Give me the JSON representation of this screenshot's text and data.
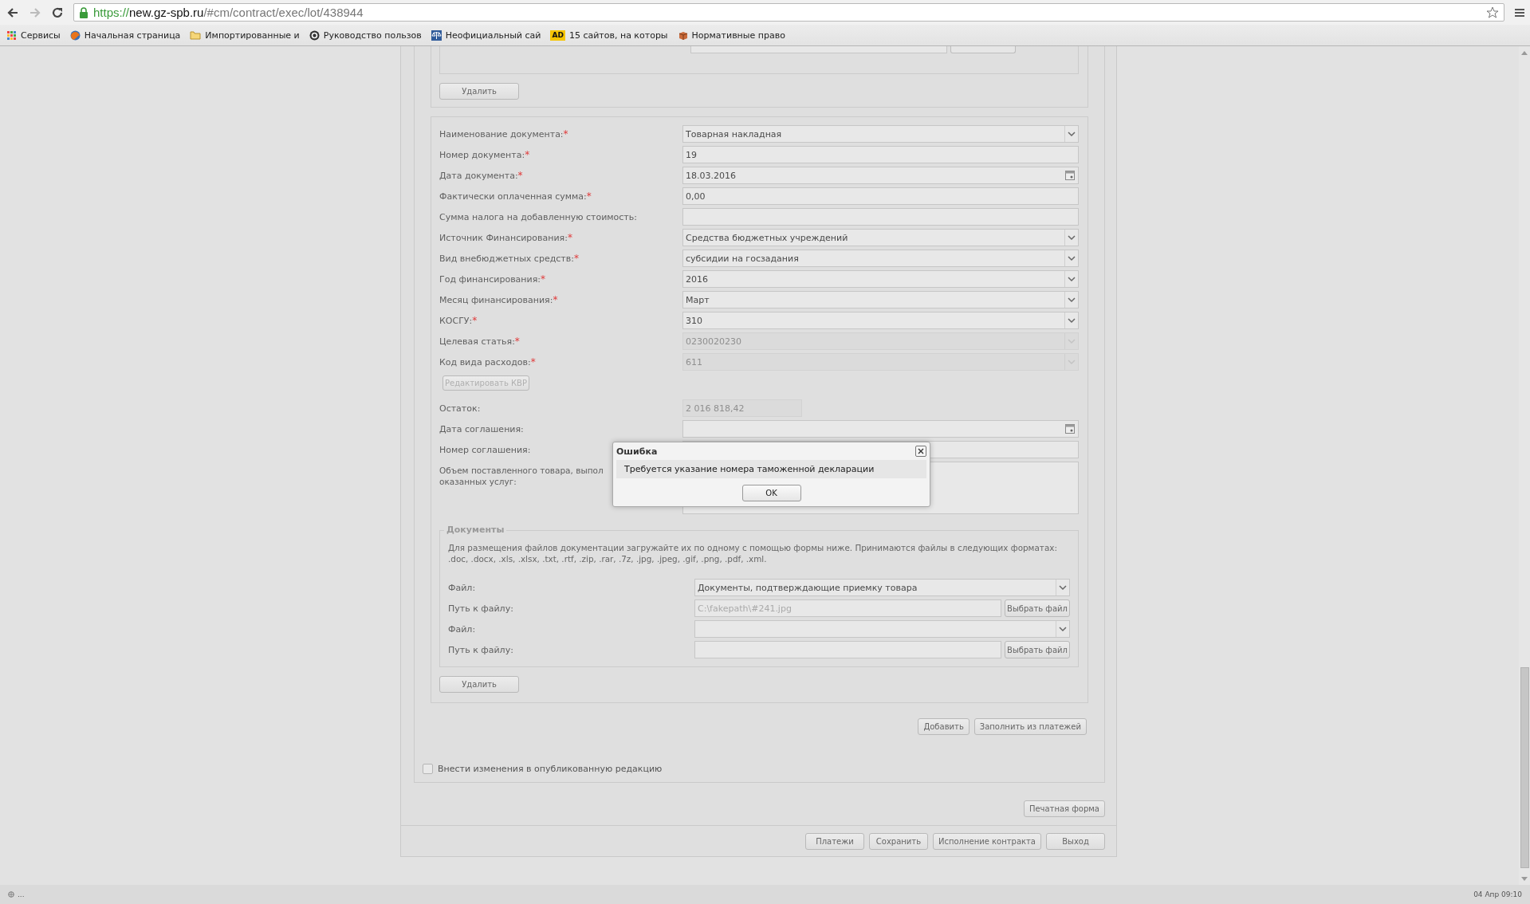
{
  "browser": {
    "url": {
      "scheme": "https://",
      "host": "new.gz-spb.ru",
      "path": "/#cm/contract/exec/lot/438944"
    },
    "bookmarks": [
      {
        "kind": "apps",
        "label": "Сервисы"
      },
      {
        "kind": "site",
        "label": "Начальная страница"
      },
      {
        "kind": "folder",
        "label": "Импортированные и"
      },
      {
        "kind": "site",
        "label": "Руководство пользов"
      },
      {
        "kind": "site",
        "label": "Неофициальный сай"
      },
      {
        "kind": "badge",
        "icon_text": "AD",
        "label": "15 сайтов, на которы"
      },
      {
        "kind": "site",
        "label": "Нормативные право"
      }
    ]
  },
  "top_section": {
    "delete_button": "Удалить"
  },
  "form": {
    "required_mark": "*",
    "rows": [
      {
        "kind": "select",
        "label": "Наименование документа:",
        "required": true,
        "disabled": false,
        "value": "Товарная накладная"
      },
      {
        "kind": "text",
        "label": "Номер документа:",
        "required": true,
        "disabled": false,
        "value": "19"
      },
      {
        "kind": "date",
        "label": "Дата документа:",
        "required": true,
        "disabled": false,
        "value": "18.03.2016"
      },
      {
        "kind": "text",
        "label": "Фактически оплаченная сумма:",
        "required": true,
        "disabled": false,
        "value": "0,00"
      },
      {
        "kind": "text",
        "label": "Сумма налога на добавленную стоимость:",
        "required": false,
        "disabled": false
      },
      {
        "kind": "select",
        "label": "Источник Финансирования:",
        "required": true,
        "disabled": false,
        "value": "Средства бюджетных учреждений"
      },
      {
        "kind": "select",
        "label": "Вид внебюджетных средств:",
        "required": true,
        "disabled": false,
        "value": "субсидии на госзадания"
      },
      {
        "kind": "select",
        "label": "Год финансирования:",
        "required": true,
        "disabled": false,
        "value": "2016"
      },
      {
        "kind": "select",
        "label": "Месяц финансирования:",
        "required": true,
        "disabled": false,
        "value": "Март"
      },
      {
        "kind": "select",
        "label": "КОСГУ:",
        "required": true,
        "disabled": false,
        "value": "310"
      },
      {
        "kind": "select",
        "label": "Целевая статья:",
        "required": true,
        "disabled": true,
        "value": "0230020230"
      },
      {
        "kind": "select",
        "label": "Код вида расходов:",
        "required": true,
        "disabled": true,
        "value": "611"
      },
      {
        "kind": "button",
        "label": "Редактировать КВР",
        "disabled": true
      },
      {
        "kind": "short",
        "label": "Остаток:",
        "required": false,
        "disabled": true,
        "value": "2 016 818,42"
      },
      {
        "kind": "date",
        "label": "Дата соглашения:",
        "required": false,
        "disabled": false
      },
      {
        "kind": "text",
        "label": "Номер соглашения:",
        "required": false,
        "disabled": false
      },
      {
        "kind": "textarea",
        "label_lines": [
          "Объем поставленного товара, выпол",
          "оказанных услуг:"
        ],
        "required": false,
        "disabled": false
      }
    ]
  },
  "documents": {
    "legend": "Документы",
    "description_lines": [
      "Для размещения файлов документации загружайте их по одному с помощью формы ниже. Принимаются файлы в следующих форматах:",
      ".doc, .docx, .xls, .xlsx, .txt, .rtf, .zip, .rar, .7z, .jpg, .jpeg, .gif, .png, .pdf, .xml."
    ],
    "files": [
      {
        "kind": "select",
        "label": "Файл:",
        "value": "Документы, подтверждающие приемку товара"
      },
      {
        "kind": "file",
        "label": "Путь к файлу:",
        "value": "C:\\fakepath\\#241.jpg",
        "button": "Выбрать файл"
      },
      {
        "kind": "select",
        "label": "Файл:"
      },
      {
        "kind": "file",
        "label": "Путь к файлу:",
        "button": "Выбрать файл"
      }
    ],
    "delete_button": "Удалить"
  },
  "actions": [
    "Добавить",
    "Заполнить из платежей"
  ],
  "publish_checkbox": {
    "label": "Внести изменения в опубликованную редакцию",
    "checked": false
  },
  "print_button": "Печатная форма",
  "footer_buttons": [
    "Платежи",
    "Сохранить",
    "Исполнение контракта",
    "Выход"
  ],
  "dialog": {
    "title": "Ошибка",
    "message": "Требуется указание номера таможенной декларации",
    "ok": "OK"
  },
  "status_bar": {
    "left": "...",
    "time": "04 Апр 09:10"
  }
}
